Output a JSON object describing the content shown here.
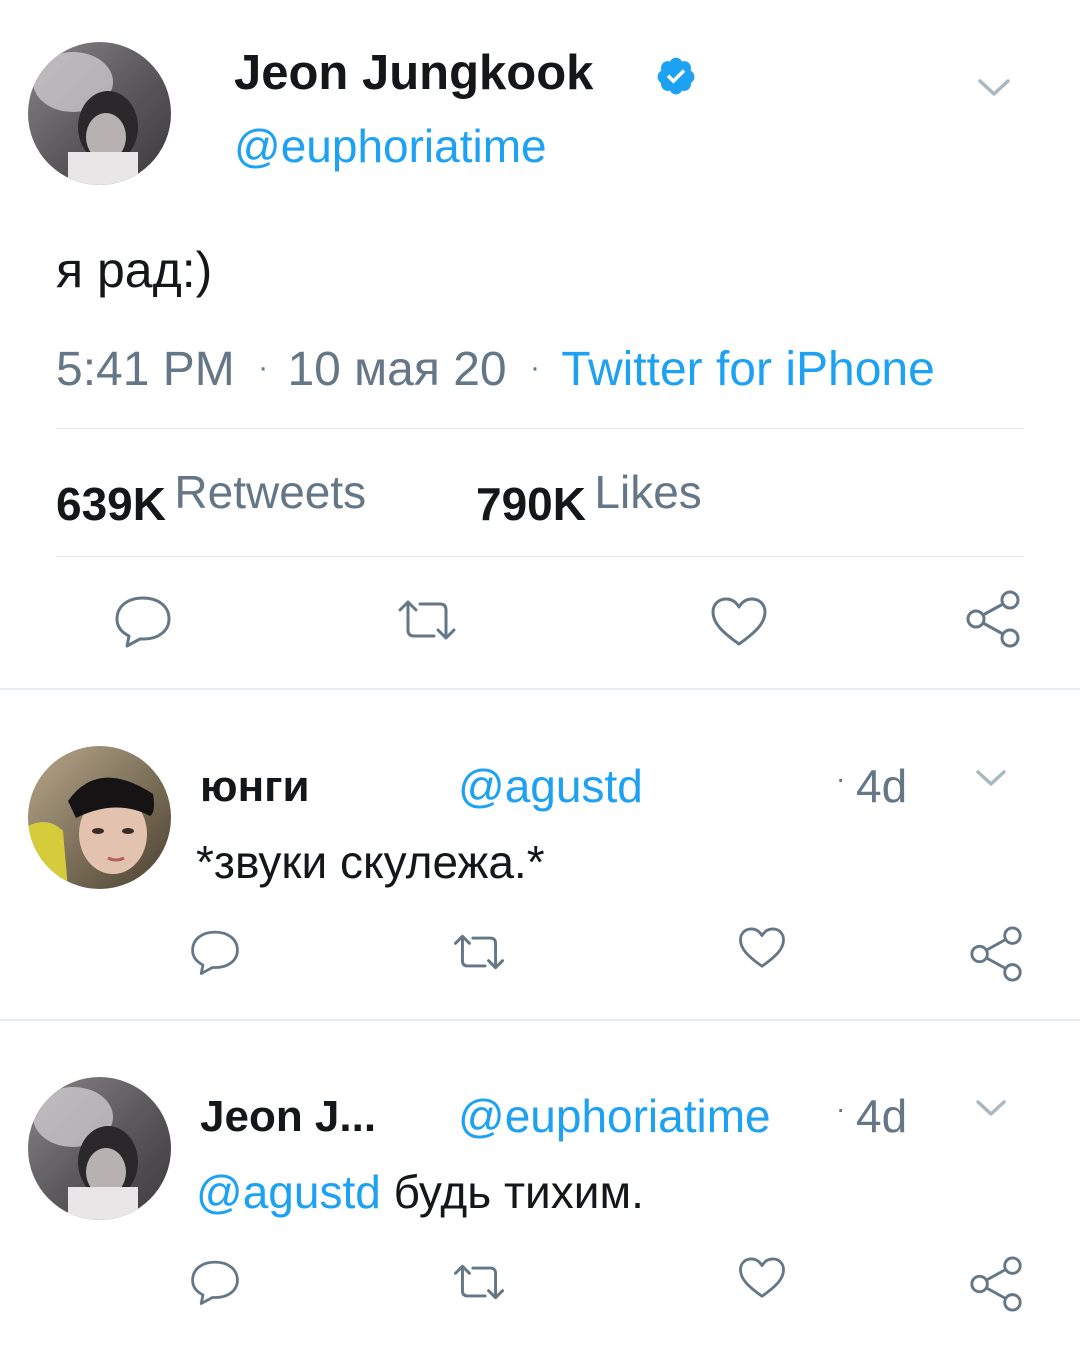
{
  "main_tweet": {
    "author_name": "Jeon Jungkook",
    "handle": "@euphoriatime",
    "text": "я рад:)",
    "time": "5:41 PM",
    "dot1": "·",
    "date": "10 мая 20",
    "dot2": "·",
    "source": "Twitter for iPhone",
    "retweets_count": "639K",
    "retweets_label": "Retweets",
    "likes_count": "790K",
    "likes_label": "Likes"
  },
  "replies": [
    {
      "author_name": "юнги",
      "handle": "@agustd",
      "time": "4d",
      "text": "*звуки скулежа.*"
    },
    {
      "author_name": "Jeon J...",
      "handle": "@euphoriatime",
      "time": "4d",
      "mention": "@agustd",
      "text": "будь тихим."
    }
  ],
  "colors": {
    "link_blue": "#1da1f2",
    "meta_gray": "#657786",
    "icon_gray": "#657786",
    "divider": "#e1e8ed"
  },
  "icons": {
    "verified": "verified-badge-icon",
    "chevron": "chevron-down-icon",
    "reply": "reply-icon",
    "retweet": "retweet-icon",
    "like": "heart-icon",
    "share": "share-icon"
  }
}
